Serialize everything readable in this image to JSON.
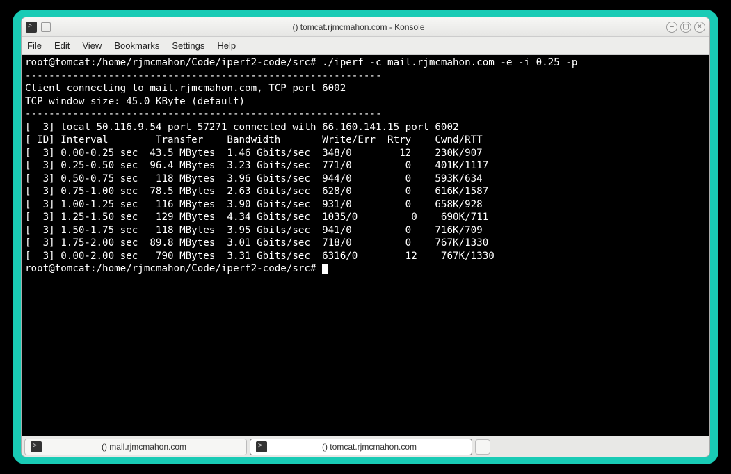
{
  "titlebar": {
    "title": "() tomcat.rjmcmahon.com - Konsole"
  },
  "menubar": [
    "File",
    "Edit",
    "View",
    "Bookmarks",
    "Settings",
    "Help"
  ],
  "terminal": {
    "prompt1": "root@tomcat:/home/rjmcmahon/Code/iperf2-code/src# ./iperf -c mail.rjmcmahon.com -e -i 0.25 -p ",
    "dash1": "------------------------------------------------------------",
    "conn": "Client connecting to mail.rjmcmahon.com, TCP port 6002",
    "win": "TCP window size: 45.0 KByte (default)",
    "dash2": "------------------------------------------------------------",
    "local": "[  3] local 50.116.9.54 port 57271 connected with 66.160.141.15 port 6002",
    "hdr": "[ ID] Interval        Transfer    Bandwidth       Write/Err  Rtry    Cwnd/RTT",
    "rows": [
      "[  3] 0.00-0.25 sec  43.5 MBytes  1.46 Gbits/sec  348/0        12    230K/907",
      "[  3] 0.25-0.50 sec  96.4 MBytes  3.23 Gbits/sec  771/0         0    401K/1117",
      "[  3] 0.50-0.75 sec   118 MBytes  3.96 Gbits/sec  944/0         0    593K/634",
      "[  3] 0.75-1.00 sec  78.5 MBytes  2.63 Gbits/sec  628/0         0    616K/1587",
      "[  3] 1.00-1.25 sec   116 MBytes  3.90 Gbits/sec  931/0         0    658K/928",
      "[  3] 1.25-1.50 sec   129 MBytes  4.34 Gbits/sec  1035/0         0    690K/711",
      "[  3] 1.50-1.75 sec   118 MBytes  3.95 Gbits/sec  941/0         0    716K/709",
      "[  3] 1.75-2.00 sec  89.8 MBytes  3.01 Gbits/sec  718/0         0    767K/1330",
      "[  3] 0.00-2.00 sec   790 MBytes  3.31 Gbits/sec  6316/0        12    767K/1330"
    ],
    "prompt2": "root@tomcat:/home/rjmcmahon/Code/iperf2-code/src# "
  },
  "tabs": [
    {
      "label": "() mail.rjmcmahon.com",
      "active": false
    },
    {
      "label": "() tomcat.rjmcmahon.com",
      "active": true
    }
  ]
}
